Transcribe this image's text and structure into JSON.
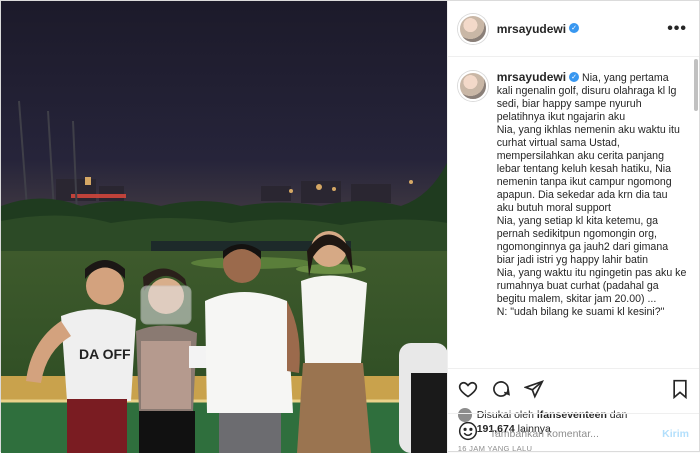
{
  "post": {
    "username": "mrsayudewi",
    "verified_glyph": "✓",
    "more_glyph": "•••",
    "caption": "Nia, yang pertama kali ngenalin golf, disuru olahraga kl lg sedi, biar happy sampe nyuruh pelatihnya ikut ngajarin aku\nNia, yang ikhlas nemenin aku waktu itu curhat virtual sama Ustad, mempersilahkan aku cerita panjang lebar tentang keluh kesah hatiku, Nia nemenin tanpa ikut campur ngomong apapun. Dia sekedar ada krn dia tau aku butuh moral support\nNia, yang setiap kl kita ketemu, ga pernah sedikitpun ngomongin org, ngomonginnya ga jauh2 dari gimana biar jadi istri yg happy lahir batin\nNia, yang waktu itu ngingetin pas aku ke rumahnya buat curhat (padahal ga begitu malem, skitar jam 20.00) ...\nN: \"udah bilang ke suami kl kesini?\"",
    "likes": {
      "prefix": "Disukai oleh ",
      "liker": "ifanseventeen",
      "mid": " dan",
      "count": "191,674",
      "suffix": " lainnya"
    },
    "timestamp": "16 JAM YANG LALU",
    "comment_placeholder": "Tambahkan komentar...",
    "send_label": "Kirim"
  },
  "icons": {
    "like": "heart-icon",
    "comment": "comment-icon",
    "share": "share-icon",
    "save": "bookmark-icon",
    "emoji": "emoji-icon"
  },
  "colors": {
    "verified": "#3897f0",
    "send_disabled": "#b2dffc",
    "muted": "#8e8e8e"
  }
}
